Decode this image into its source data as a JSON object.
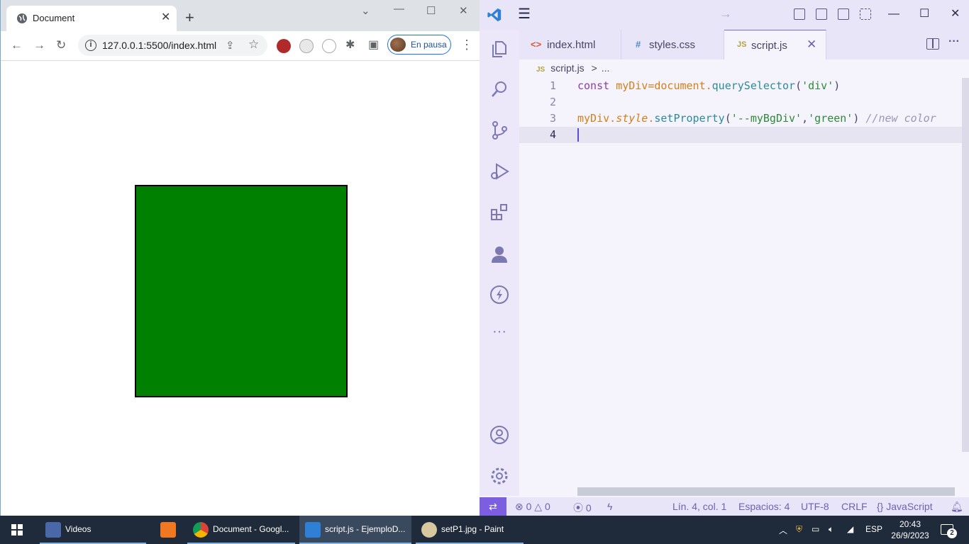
{
  "chrome": {
    "tab_title": "Document",
    "new_tab": "+",
    "url": "127.0.0.1:5500/index.html",
    "profile_label": "En pausa",
    "demo_box_color": "#008000"
  },
  "vscode": {
    "tabs": [
      {
        "icon": "<>",
        "label": "index.html",
        "icon_color": "#d35a3a"
      },
      {
        "icon": "#",
        "label": "styles.css",
        "icon_color": "#4a8ac8"
      },
      {
        "icon": "JS",
        "label": "script.js",
        "icon_color": "#b5a23a"
      }
    ],
    "breadcrumb": {
      "file_icon": "JS",
      "file": "script.js",
      "sep": ">",
      "rest": "..."
    },
    "code": {
      "line_numbers": [
        "1",
        "2",
        "3",
        "4"
      ],
      "line1": {
        "kw": "const ",
        "var": "myDiv",
        "eq": "=",
        "obj": "document",
        "dot": ".",
        "fn": "querySelector",
        "open": "(",
        "str": "'div'",
        "close": ")"
      },
      "line3": {
        "var": "myDiv",
        "dot1": ".",
        "prop": "style",
        "dot2": ".",
        "fn": "setProperty",
        "open": "(",
        "str1": "'--myBgDiv'",
        "comma": ",",
        "str2": "'green'",
        "close": ")",
        "comment": " //new color"
      }
    },
    "status": {
      "errors": "0",
      "warnings": "0",
      "ports": "0",
      "position": "Lín. 4, col. 1",
      "spaces": "Espacios: 4",
      "encoding": "UTF-8",
      "eol": "CRLF",
      "language": "JavaScript"
    }
  },
  "taskbar": {
    "apps": [
      {
        "label": "Videos"
      },
      {
        "label": ""
      },
      {
        "label": "Document - Googl..."
      },
      {
        "label": "script.js - EjemploD..."
      },
      {
        "label": "setP1.jpg - Paint"
      }
    ],
    "lang": "ESP",
    "time": "20:43",
    "date": "26/9/2023",
    "notifications": "2"
  }
}
